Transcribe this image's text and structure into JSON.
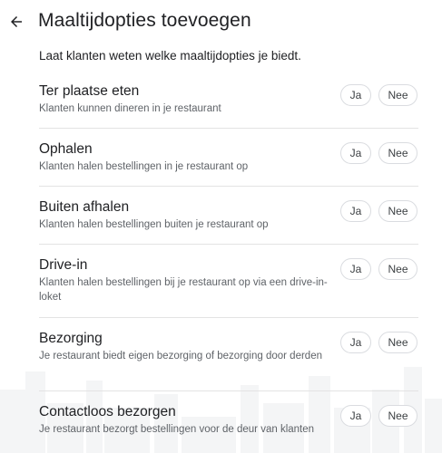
{
  "header": {
    "title": "Maaltijdopties toevoegen",
    "back_icon": "arrow-left-icon"
  },
  "subtitle": "Laat klanten weten welke maaltijdopties je biedt.",
  "options": [
    {
      "title": "Ter plaatse eten",
      "description": "Klanten kunnen dineren in je restaurant",
      "yes_label": "Ja",
      "no_label": "Nee"
    },
    {
      "title": "Ophalen",
      "description": "Klanten halen bestellingen in je restaurant op",
      "yes_label": "Ja",
      "no_label": "Nee"
    },
    {
      "title": "Buiten afhalen",
      "description": "Klanten halen bestellingen buiten je restaurant op",
      "yes_label": "Ja",
      "no_label": "Nee"
    },
    {
      "title": "Drive-in",
      "description": "Klanten halen bestellingen bij je restaurant op via een drive-in-loket",
      "yes_label": "Ja",
      "no_label": "Nee"
    },
    {
      "title": "Bezorging",
      "description": "Je restaurant biedt eigen bezorging of bezorging door derden",
      "yes_label": "Ja",
      "no_label": "Nee"
    },
    {
      "title": "Contactloos bezorgen",
      "description": "Je restaurant bezorgt bestellingen voor de deur van klanten",
      "yes_label": "Ja",
      "no_label": "Nee"
    }
  ]
}
